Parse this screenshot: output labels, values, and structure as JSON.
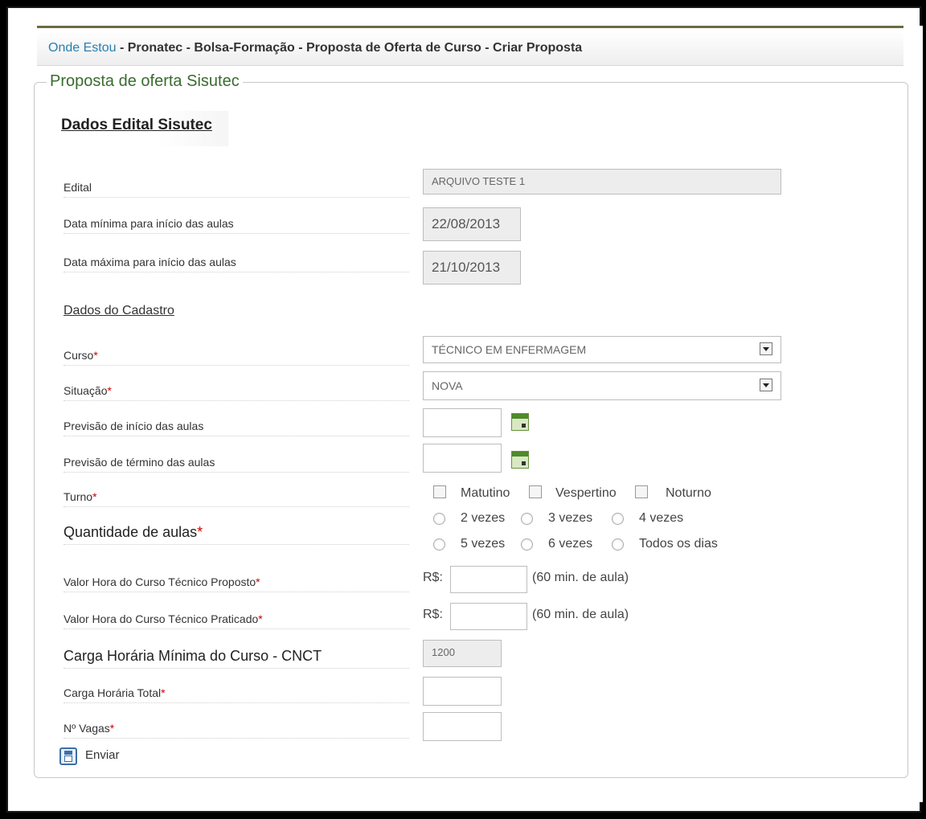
{
  "breadcrumb": {
    "here": "Onde Estou",
    "path": " - Pronatec - Bolsa-Formação - Proposta de Oferta de Curso - Criar Proposta"
  },
  "panel": {
    "legend": "Proposta de oferta Sisutec",
    "section_title": "Dados Edital Sisutec"
  },
  "edital": {
    "edital_label": "Edital",
    "edital_value": "ARQUIVO TESTE 1",
    "data_min_label": "Data mínima para início das aulas",
    "data_min_value": "22/08/2013",
    "data_max_label": "Data máxima para início das aulas",
    "data_max_value": "21/10/2013"
  },
  "cadastro": {
    "title": "Dados do Cadastro",
    "curso_label": "Curso",
    "curso_value": "TÉCNICO EM ENFERMAGEM",
    "situacao_label": "Situação",
    "situacao_value": "NOVA",
    "prev_inicio_label": "Previsão de início das aulas",
    "prev_termino_label": "Previsão de término das aulas",
    "turno_label": "Turno",
    "turno_options": [
      "Matutino",
      "Vespertino",
      "Noturno"
    ],
    "quantidade_label": "Quantidade de aulas",
    "quantidade_options": [
      "2 vezes",
      "3 vezes",
      "4 vezes",
      "5 vezes",
      "6 vezes",
      "Todos os dias"
    ],
    "valor_proposto_label": "Valor Hora do Curso Técnico Proposto",
    "valor_praticado_label": "Valor Hora do Curso Técnico Praticado",
    "currency": "R$:",
    "unit_note": "(60 min. de aula)",
    "carga_min_label": "Carga Horária Mínima do Curso - CNCT",
    "carga_min_value": "1200",
    "carga_total_label": "Carga Horária Total",
    "vagas_label": "Nº Vagas",
    "required_mark": "*"
  },
  "actions": {
    "send_label": "Enviar"
  },
  "colors": {
    "link": "#2a7fb0",
    "legend": "#3a6b2f",
    "required": "#cc0000"
  }
}
